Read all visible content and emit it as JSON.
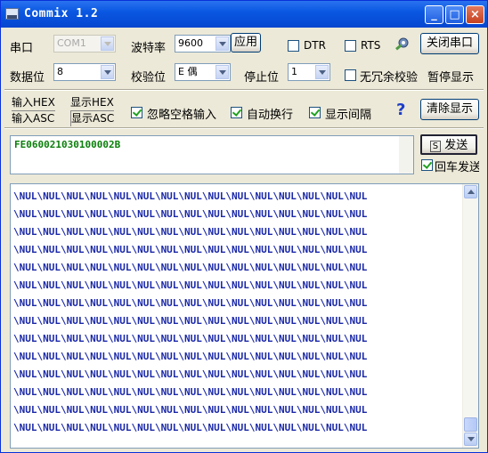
{
  "titlebar": {
    "title": "Commix 1.2",
    "minimize": "_",
    "maximize": "□",
    "close": "×"
  },
  "row1": {
    "port_label": "串口",
    "port_value": "COM1",
    "baud_label": "波特率",
    "baud_value": "9600",
    "apply_label": "应用",
    "dtr_label": "DTR",
    "rts_label": "RTS",
    "close_port_label": "关闭串口"
  },
  "row2": {
    "databits_label": "数据位",
    "databits_value": "8",
    "parity_label": "校验位",
    "parity_value": "E 偶",
    "stopbits_label": "停止位",
    "stopbits_value": "1",
    "no_redundant_label": "无冗余校验",
    "pause_label": "暂停显示"
  },
  "row3": {
    "input_hex": "输入HEX",
    "input_asc": "输入ASC",
    "display_hex": "显示HEX",
    "display_asc": "显示ASC",
    "ignore_space_label": "忽略空格输入",
    "auto_wrap_label": "自动换行",
    "show_interval_label": "显示间隔",
    "help_icon_text": "?",
    "clear_display_label": "清除显示"
  },
  "send": {
    "text": "FE060021030100002B",
    "send_button_label": "发送",
    "send_button_key": "S",
    "enter_send_label": "回车发送"
  },
  "receive": {
    "lines": [
      "\\NUL\\NUL\\NUL\\NUL\\NUL\\NUL\\NUL\\NUL\\NUL\\NUL\\NUL\\NUL\\NUL\\NUL\\NUL",
      "\\NUL\\NUL\\NUL\\NUL\\NUL\\NUL\\NUL\\NUL\\NUL\\NUL\\NUL\\NUL\\NUL\\NUL\\NUL",
      "\\NUL\\NUL\\NUL\\NUL\\NUL\\NUL\\NUL\\NUL\\NUL\\NUL\\NUL\\NUL\\NUL\\NUL\\NUL",
      "\\NUL\\NUL\\NUL\\NUL\\NUL\\NUL\\NUL\\NUL\\NUL\\NUL\\NUL\\NUL\\NUL\\NUL\\NUL",
      "\\NUL\\NUL\\NUL\\NUL\\NUL\\NUL\\NUL\\NUL\\NUL\\NUL\\NUL\\NUL\\NUL\\NUL\\NUL",
      "\\NUL\\NUL\\NUL\\NUL\\NUL\\NUL\\NUL\\NUL\\NUL\\NUL\\NUL\\NUL\\NUL\\NUL\\NUL",
      "\\NUL\\NUL\\NUL\\NUL\\NUL\\NUL\\NUL\\NUL\\NUL\\NUL\\NUL\\NUL\\NUL\\NUL\\NUL",
      "\\NUL\\NUL\\NUL\\NUL\\NUL\\NUL\\NUL\\NUL\\NUL\\NUL\\NUL\\NUL\\NUL\\NUL\\NUL",
      "\\NUL\\NUL\\NUL\\NUL\\NUL\\NUL\\NUL\\NUL\\NUL\\NUL\\NUL\\NUL\\NUL\\NUL\\NUL",
      "\\NUL\\NUL\\NUL\\NUL\\NUL\\NUL\\NUL\\NUL\\NUL\\NUL\\NUL\\NUL\\NUL\\NUL\\NUL",
      "\\NUL\\NUL\\NUL\\NUL\\NUL\\NUL\\NUL\\NUL\\NUL\\NUL\\NUL\\NUL\\NUL\\NUL\\NUL",
      "\\NUL\\NUL\\NUL\\NUL\\NUL\\NUL\\NUL\\NUL\\NUL\\NUL\\NUL\\NUL\\NUL\\NUL\\NUL",
      "\\NUL\\NUL\\NUL\\NUL\\NUL\\NUL\\NUL\\NUL\\NUL\\NUL\\NUL\\NUL\\NUL\\NUL\\NUL",
      "\\NUL\\NUL\\NUL\\NUL\\NUL\\NUL\\NUL\\NUL\\NUL\\NUL\\NUL\\NUL\\NUL\\NUL\\NUL"
    ]
  },
  "colors": {
    "titlebar": "#0A58E2",
    "received_text": "#1A28A8",
    "send_text": "#0A7F0A",
    "window_bg": "#ECE9D8"
  }
}
